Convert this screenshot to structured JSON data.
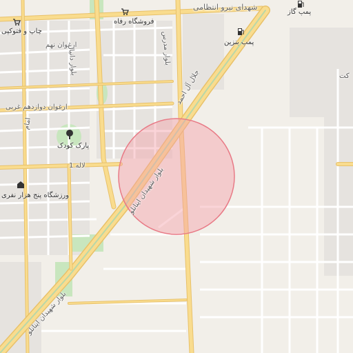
{
  "map": {
    "highlight_color": "#f4a0a8",
    "colors": {
      "background": "#f2efe9",
      "block": "#e6e3df",
      "road_minor": "#ffffff",
      "road_major": "#f9dc8e",
      "road_major_edge": "#e8c16a",
      "park": "#c8e6be"
    },
    "labels": {
      "shohadaye_niroo": "شهدای نیرو انتظامی",
      "pomp_gaz": "پمپ گاز",
      "pomp_benzin": "پمپ بنزین",
      "forushgah_refah": "فروشگاه رفاه",
      "chap_fotokopi": "چاپ و فتوکپی",
      "arghavan_nohom": "ارغوان نهم",
      "bolvar_danial": "بلوار دانیال",
      "bolvar_modares": "بلوار مدرس",
      "arghavan_davazdahom": "ارغوان دوازدهم غربی",
      "jalal_al_ahmad": "جلال آل احمد",
      "park_kudak": "پارک کودک",
      "emam": "امام",
      "laleh_1": "لاله 1",
      "varzeshgah": "ورزشگاه پنج هزار نفری",
      "bolvar_shohadaye_ilam_1": "بلوار شهیدان اینانلو",
      "bolvar_shohadaye_ilam_2": "بلوار شهیدان اینانلو",
      "kt": "کت"
    },
    "icons": [
      "shopping-cart-icon",
      "gas-station-icon",
      "fuel-pump-icon",
      "tree-icon",
      "stadium-icon"
    ]
  }
}
